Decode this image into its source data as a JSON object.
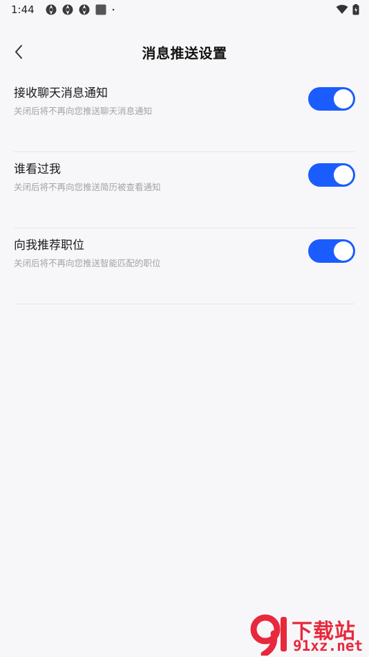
{
  "status_bar": {
    "time": "1:44",
    "icons": [
      "aperture-icon",
      "aperture-icon",
      "aperture-icon",
      "square-app-icon",
      "dot-icon"
    ],
    "right_icons": [
      "wifi-icon",
      "battery-charging-icon"
    ]
  },
  "header": {
    "title": "消息推送设置",
    "back_icon": "chevron-left-icon"
  },
  "settings": [
    {
      "title": "接收聊天消息通知",
      "description": "关闭后将不再向您推送聊天消息通知",
      "enabled": true
    },
    {
      "title": "谁看过我",
      "description": "关闭后将不再向您推送简历被查看通知",
      "enabled": true
    },
    {
      "title": "向我推荐职位",
      "description": "关闭后将不再向您推送智能匹配的职位",
      "enabled": true
    }
  ],
  "watermark": {
    "line1": "下载站",
    "line2": "91xz.net"
  },
  "colors": {
    "toggle_on": "#1b5cff",
    "background": "#f7f7f9",
    "watermark": "#e8283c"
  }
}
